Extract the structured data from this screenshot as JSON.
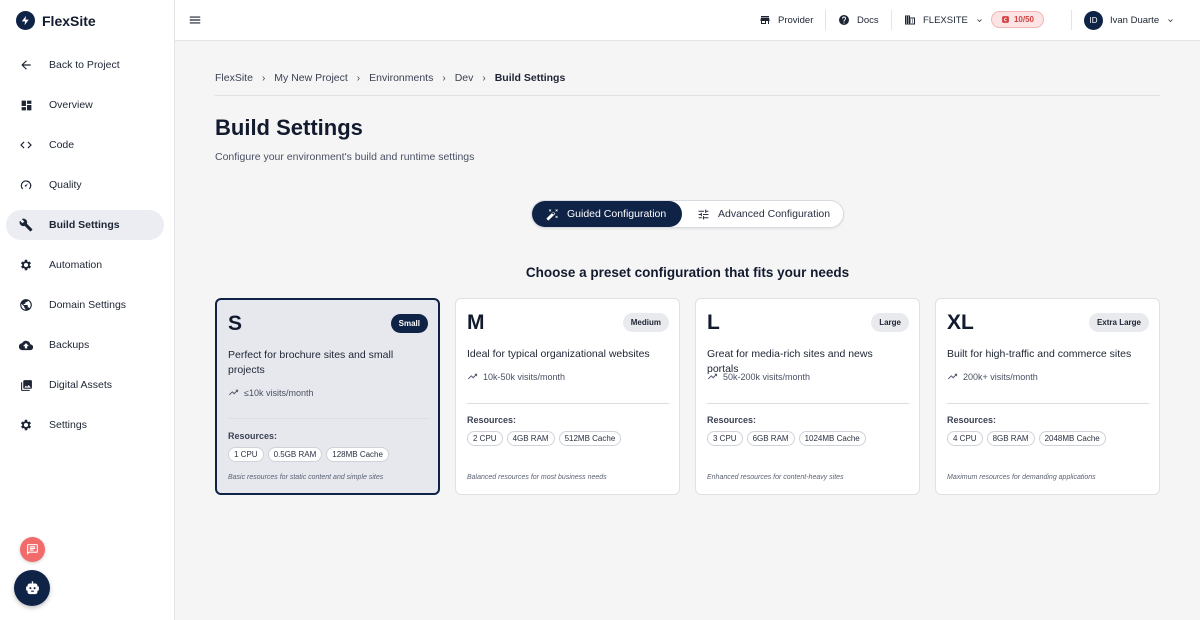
{
  "brand": {
    "name": "FlexSite"
  },
  "sidebar": {
    "items": [
      {
        "label": "Back to Project",
        "icon": "arrow-left-icon"
      },
      {
        "label": "Overview",
        "icon": "dashboard-icon"
      },
      {
        "label": "Code",
        "icon": "code-icon"
      },
      {
        "label": "Quality",
        "icon": "gauge-icon"
      },
      {
        "label": "Build Settings",
        "icon": "wrench-icon",
        "active": true
      },
      {
        "label": "Automation",
        "icon": "gear-icon"
      },
      {
        "label": "Domain Settings",
        "icon": "globe-icon"
      },
      {
        "label": "Backups",
        "icon": "cloud-upload-icon"
      },
      {
        "label": "Digital Assets",
        "icon": "image-icon"
      },
      {
        "label": "Settings",
        "icon": "gear-icon"
      }
    ]
  },
  "topbar": {
    "provider": "Provider",
    "docs": "Docs",
    "org": "FLEXSITE",
    "usage": "10/50",
    "user_initials": "ID",
    "user_name": "Ivan Duarte"
  },
  "breadcrumb": [
    "FlexSite",
    "My New Project",
    "Environments",
    "Dev",
    "Build Settings"
  ],
  "page": {
    "title": "Build Settings",
    "subtitle": "Configure your environment's build and runtime settings"
  },
  "config_toggle": {
    "guided": "Guided Configuration",
    "advanced": "Advanced Configuration",
    "active": "guided"
  },
  "presets": {
    "heading": "Choose a preset configuration that fits your needs",
    "resources_label": "Resources:",
    "cards": [
      {
        "letter": "S",
        "badge": "Small",
        "description": "Perfect for brochure sites and small projects",
        "visits": "≤10k visits/month",
        "resources": [
          "1 CPU",
          "0.5GB RAM",
          "128MB Cache"
        ],
        "note": "Basic resources for static content and simple sites",
        "selected": true
      },
      {
        "letter": "M",
        "badge": "Medium",
        "description": "Ideal for typical organizational websites",
        "visits": "10k-50k visits/month",
        "resources": [
          "2 CPU",
          "4GB RAM",
          "512MB Cache"
        ],
        "note": "Balanced resources for most business needs",
        "selected": false
      },
      {
        "letter": "L",
        "badge": "Large",
        "description": "Great for media-rich sites and news portals",
        "visits": "50k-200k visits/month",
        "resources": [
          "3 CPU",
          "6GB RAM",
          "1024MB Cache"
        ],
        "note": "Enhanced resources for content-heavy sites",
        "selected": false
      },
      {
        "letter": "XL",
        "badge": "Extra Large",
        "description": "Built for high-traffic and commerce sites",
        "visits": "200k+ visits/month",
        "resources": [
          "4 CPU",
          "8GB RAM",
          "2048MB Cache"
        ],
        "note": "Maximum resources for demanding applications",
        "selected": false
      }
    ]
  },
  "colors": {
    "primary": "#0f2346",
    "danger": "#f26b6b",
    "selected_card_bg": "#e6e8ee"
  }
}
